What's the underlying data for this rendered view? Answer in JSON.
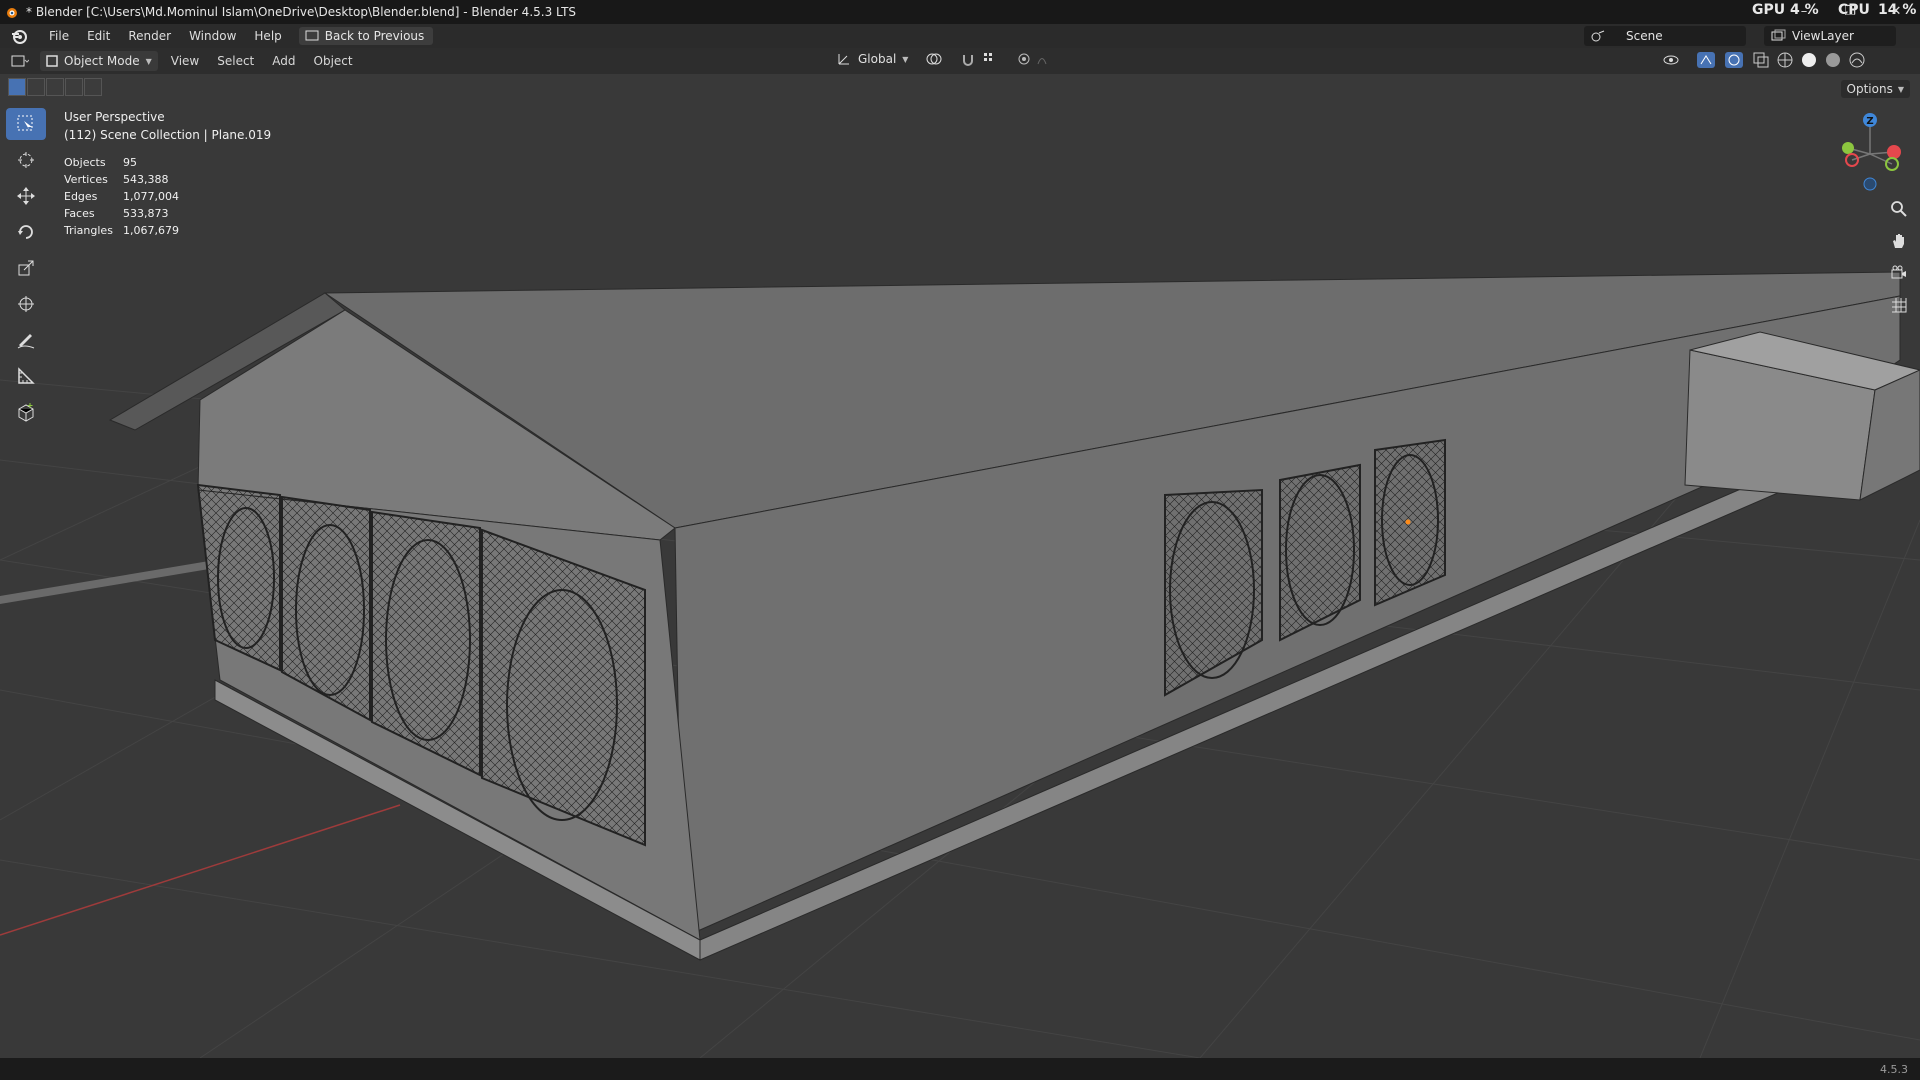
{
  "window": {
    "title": "* Blender [C:\\Users\\Md.Mominul Islam\\OneDrive\\Desktop\\Blender.blend] - Blender 4.5.3 LTS",
    "gpu_label": "GPU",
    "gpu_value": "4 %",
    "cpu_label": "CPU",
    "cpu_value": "14 %",
    "minimize": "–",
    "maximize": "❐",
    "close": "✕"
  },
  "menubar": {
    "items": [
      "File",
      "Edit",
      "Render",
      "Window",
      "Help"
    ],
    "back_button": "Back to Previous",
    "scene": "Scene",
    "view_layer": "ViewLayer"
  },
  "header3d": {
    "mode": "Object Mode",
    "menus": [
      "View",
      "Select",
      "Add",
      "Object"
    ],
    "orientation": "Global"
  },
  "viewport": {
    "perspective": "User Perspective",
    "collection": "(112) Scene Collection | Plane.019",
    "options": "Options",
    "stats": [
      {
        "label": "Objects",
        "value": "95"
      },
      {
        "label": "Vertices",
        "value": "543,388"
      },
      {
        "label": "Edges",
        "value": "1,077,004"
      },
      {
        "label": "Faces",
        "value": "533,873"
      },
      {
        "label": "Triangles",
        "value": "1,067,679"
      }
    ],
    "gizmo": {
      "z": "Z",
      "x_color": "#e5484d",
      "y_color": "#8cc63f",
      "z_color": "#3f87d9"
    }
  },
  "statusbar": {
    "version": "4.5.3"
  },
  "colors": {
    "accent": "#4772b3",
    "viewport_bg": "#393939",
    "grid": "#444444"
  }
}
